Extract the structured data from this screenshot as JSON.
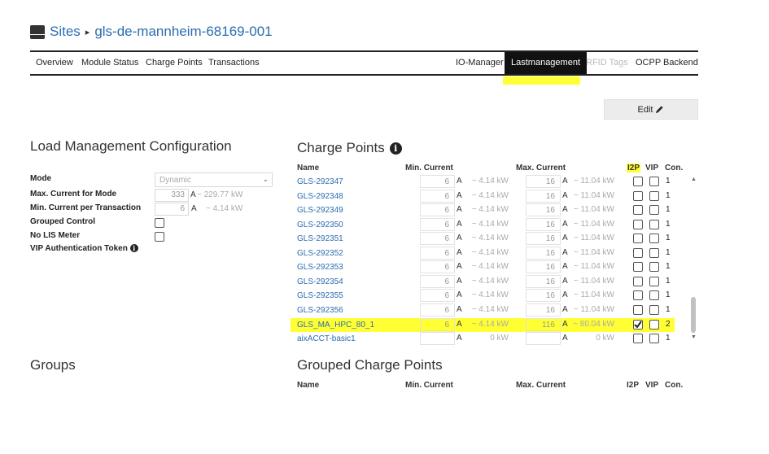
{
  "header": {
    "sites": "Sites",
    "sep": "▸",
    "site_id": "gls-de-mannheim-68169-001"
  },
  "nav": {
    "overview": "Overview",
    "module_status": "Module Status",
    "charge_points": "Charge Points",
    "transactions": "Transactions",
    "io_manager": "IO-Manager",
    "lastmanagement": "Lastmanagement",
    "rfid_tags": "RFID Tags",
    "ocpp_backend": "OCPP Backend"
  },
  "edit": {
    "label": "Edit"
  },
  "lm": {
    "title": "Load Management Configuration",
    "mode_label": "Mode",
    "mode_value": "Dynamic",
    "max_current_label": "Max. Current for Mode",
    "max_current_value": "333",
    "max_current_unit": "A",
    "max_current_kw": "~ 229.77 kW",
    "min_current_label": "Min. Current per Transaction",
    "min_current_value": "6",
    "min_current_unit": "A",
    "min_current_kw": "~ 4.14 kW",
    "grouped_label": "Grouped Control",
    "nolis_label": "No LIS Meter",
    "vip_label": "VIP Authentication Token"
  },
  "cp": {
    "title": "Charge Points",
    "cols": {
      "name": "Name",
      "min": "Min. Current",
      "max": "Max. Current",
      "i2p": "I2P",
      "vip": "VIP",
      "con": "Con."
    },
    "rows": [
      {
        "name": "GLS-292347",
        "min": "6",
        "min_unit": "A",
        "min_kw": "~ 4.14 kW",
        "max": "16",
        "max_unit": "A",
        "max_kw": "~ 11.04 kW",
        "i2p": false,
        "vip": false,
        "con": "1"
      },
      {
        "name": "GLS-292348",
        "min": "6",
        "min_unit": "A",
        "min_kw": "~ 4.14 kW",
        "max": "16",
        "max_unit": "A",
        "max_kw": "~ 11.04 kW",
        "i2p": false,
        "vip": false,
        "con": "1"
      },
      {
        "name": "GLS-292349",
        "min": "6",
        "min_unit": "A",
        "min_kw": "~ 4.14 kW",
        "max": "16",
        "max_unit": "A",
        "max_kw": "~ 11.04 kW",
        "i2p": false,
        "vip": false,
        "con": "1"
      },
      {
        "name": "GLS-292350",
        "min": "6",
        "min_unit": "A",
        "min_kw": "~ 4.14 kW",
        "max": "16",
        "max_unit": "A",
        "max_kw": "~ 11.04 kW",
        "i2p": false,
        "vip": false,
        "con": "1"
      },
      {
        "name": "GLS-292351",
        "min": "6",
        "min_unit": "A",
        "min_kw": "~ 4.14 kW",
        "max": "16",
        "max_unit": "A",
        "max_kw": "~ 11.04 kW",
        "i2p": false,
        "vip": false,
        "con": "1"
      },
      {
        "name": "GLS-292352",
        "min": "6",
        "min_unit": "A",
        "min_kw": "~ 4.14 kW",
        "max": "16",
        "max_unit": "A",
        "max_kw": "~ 11.04 kW",
        "i2p": false,
        "vip": false,
        "con": "1"
      },
      {
        "name": "GLS-292353",
        "min": "6",
        "min_unit": "A",
        "min_kw": "~ 4.14 kW",
        "max": "16",
        "max_unit": "A",
        "max_kw": "~ 11.04 kW",
        "i2p": false,
        "vip": false,
        "con": "1"
      },
      {
        "name": "GLS-292354",
        "min": "6",
        "min_unit": "A",
        "min_kw": "~ 4.14 kW",
        "max": "16",
        "max_unit": "A",
        "max_kw": "~ 11.04 kW",
        "i2p": false,
        "vip": false,
        "con": "1"
      },
      {
        "name": "GLS-292355",
        "min": "6",
        "min_unit": "A",
        "min_kw": "~ 4.14 kW",
        "max": "16",
        "max_unit": "A",
        "max_kw": "~ 11.04 kW",
        "i2p": false,
        "vip": false,
        "con": "1"
      },
      {
        "name": "GLS-292356",
        "min": "6",
        "min_unit": "A",
        "min_kw": "~ 4.14 kW",
        "max": "16",
        "max_unit": "A",
        "max_kw": "~ 11.04 kW",
        "i2p": false,
        "vip": false,
        "con": "1"
      },
      {
        "name": "GLS_MA_HPC_80_1",
        "min": "6",
        "min_unit": "A",
        "min_kw": "~ 4.14 kW",
        "max": "116",
        "max_unit": "A",
        "max_kw": "~ 80.04 kW",
        "i2p": true,
        "vip": false,
        "con": "2",
        "highlight": true
      },
      {
        "name": "aixACCT-basic1",
        "min": "",
        "min_unit": "A",
        "min_kw": "0 kW",
        "max": "",
        "max_unit": "A",
        "max_kw": "0 kW",
        "i2p": false,
        "vip": false,
        "con": "1"
      }
    ]
  },
  "groups": {
    "title": "Groups"
  },
  "gcp": {
    "title": "Grouped Charge Points",
    "cols": {
      "name": "Name",
      "min": "Min. Current",
      "max": "Max. Current",
      "i2p": "I2P",
      "vip": "VIP",
      "con": "Con."
    }
  },
  "colors": {
    "link": "#2a6cb0",
    "highlight": "#ffff33",
    "active_tab": "#111111"
  }
}
